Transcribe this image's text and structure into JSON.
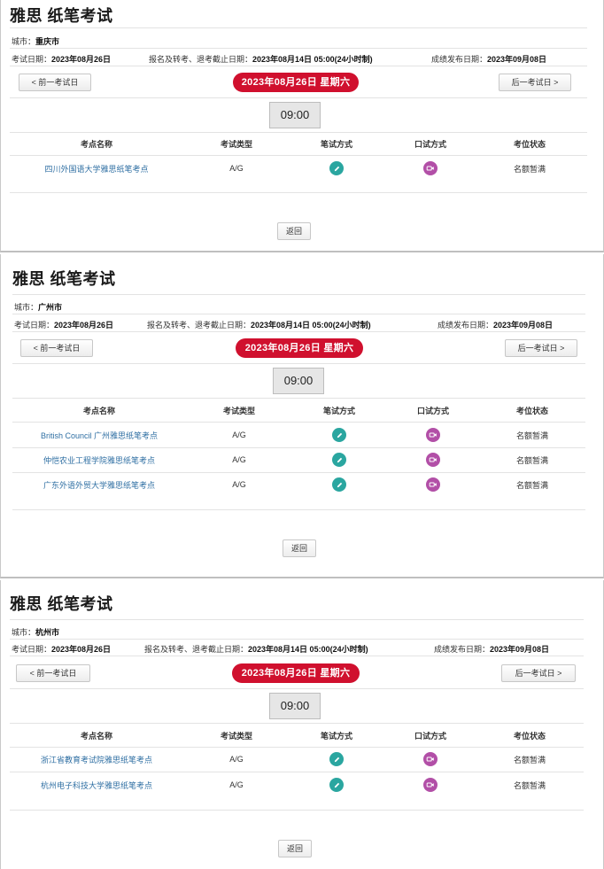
{
  "sections": [
    {
      "title": "雅思 纸笔考试",
      "city_label": "城市：",
      "city": "重庆市",
      "exam_date_label": "考试日期：",
      "exam_date": "2023年08月26日",
      "deadline_label": "报名及转考、退考截止日期：",
      "deadline": "2023年08月14日 05:00(24小时制)",
      "result_label": "成绩发布日期：",
      "result_date": "2023年09月08日",
      "prev_label": "< 前一考试日",
      "next_label": "后一考试日 >",
      "date_pill": "2023年08月26日 星期六",
      "time": "09:00",
      "headers": [
        "考点名称",
        "考试类型",
        "笔试方式",
        "口试方式",
        "考位状态"
      ],
      "rows": [
        {
          "name": "四川外国语大学雅思纸笔考点",
          "type": "A/G",
          "status": "名额暂满"
        }
      ],
      "back_label": "返回"
    },
    {
      "title": "雅思 纸笔考试",
      "city_label": "城市：",
      "city": "广州市",
      "exam_date_label": "考试日期：",
      "exam_date": "2023年08月26日",
      "deadline_label": "报名及转考、退考截止日期：",
      "deadline": "2023年08月14日 05:00(24小时制)",
      "result_label": "成绩发布日期：",
      "result_date": "2023年09月08日",
      "prev_label": "< 前一考试日",
      "next_label": "后一考试日 >",
      "date_pill": "2023年08月26日 星期六",
      "time": "09:00",
      "headers": [
        "考点名称",
        "考试类型",
        "笔试方式",
        "口试方式",
        "考位状态"
      ],
      "rows": [
        {
          "name": "British Council 广州雅思纸笔考点",
          "type": "A/G",
          "status": "名额暂满"
        },
        {
          "name": "仲恺农业工程学院雅思纸笔考点",
          "type": "A/G",
          "status": "名额暂满"
        },
        {
          "name": "广东外语外贸大学雅思纸笔考点",
          "type": "A/G",
          "status": "名额暂满"
        }
      ],
      "back_label": "返回"
    },
    {
      "title": "雅思 纸笔考试",
      "city_label": "城市：",
      "city": "杭州市",
      "exam_date_label": "考试日期：",
      "exam_date": "2023年08月26日",
      "deadline_label": "报名及转考、退考截止日期：",
      "deadline": "2023年08月14日 05:00(24小时制)",
      "result_label": "成绩发布日期：",
      "result_date": "2023年09月08日",
      "prev_label": "< 前一考试日",
      "next_label": "后一考试日 >",
      "date_pill": "2023年08月26日 星期六",
      "time": "09:00",
      "headers": [
        "考点名称",
        "考试类型",
        "笔试方式",
        "口试方式",
        "考位状态"
      ],
      "rows": [
        {
          "name": "浙江省教育考试院雅思纸笔考点",
          "type": "A/G",
          "status": "名额暂满"
        },
        {
          "name": "杭州电子科技大学雅思纸笔考点",
          "type": "A/G",
          "status": "名额暂满"
        }
      ],
      "back_label": "返回"
    }
  ],
  "icons": {
    "written": "pencil-icon",
    "oral": "video-camera-icon"
  },
  "colors": {
    "date_pill": "#d0102e",
    "link": "#2f6fa3",
    "pen_icon": "#2aa6a0",
    "oral_icon": "#b24fa7"
  }
}
